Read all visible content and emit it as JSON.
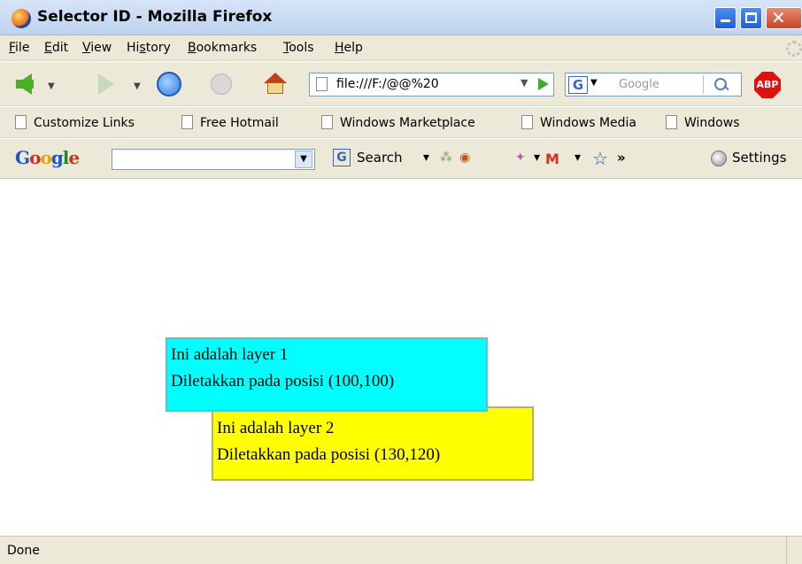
{
  "window": {
    "title": "Selector ID - Mozilla Firefox"
  },
  "menu": {
    "items": [
      "File",
      "Edit",
      "View",
      "History",
      "Bookmarks",
      "Tools",
      "Help"
    ],
    "accelerators": [
      "F",
      "E",
      "V",
      "s",
      "B",
      "T",
      "H"
    ]
  },
  "navigation": {
    "url": "file:///F:/@@%20",
    "search_placeholder": "Google",
    "adblock_label": "ABP"
  },
  "bookmarks": [
    "Customize Links",
    "Free Hotmail",
    "Windows Marketplace",
    "Windows Media",
    "Windows"
  ],
  "google_toolbar": {
    "logo": "Google",
    "search_label": "Search",
    "more_label": "»",
    "settings_label": "Settings"
  },
  "content": {
    "layer1": {
      "line1": "Ini adalah layer 1",
      "line2": "Diletakkan pada posisi (100,100)",
      "color": "#00ffff"
    },
    "layer2": {
      "line1": "Ini adalah layer 2",
      "line2": "Diletakkan pada posisi (130,120)",
      "color": "#ffff00"
    }
  },
  "status": {
    "text": "Done"
  },
  "icons": [
    "firefox-icon",
    "back-arrow-icon",
    "forward-arrow-icon",
    "reload-icon",
    "stop-icon",
    "home-icon",
    "page-icon",
    "go-icon",
    "google-g-icon",
    "magnifier-icon",
    "adblock-icon",
    "gmail-icon",
    "bookmark-star-icon",
    "settings-icon"
  ]
}
